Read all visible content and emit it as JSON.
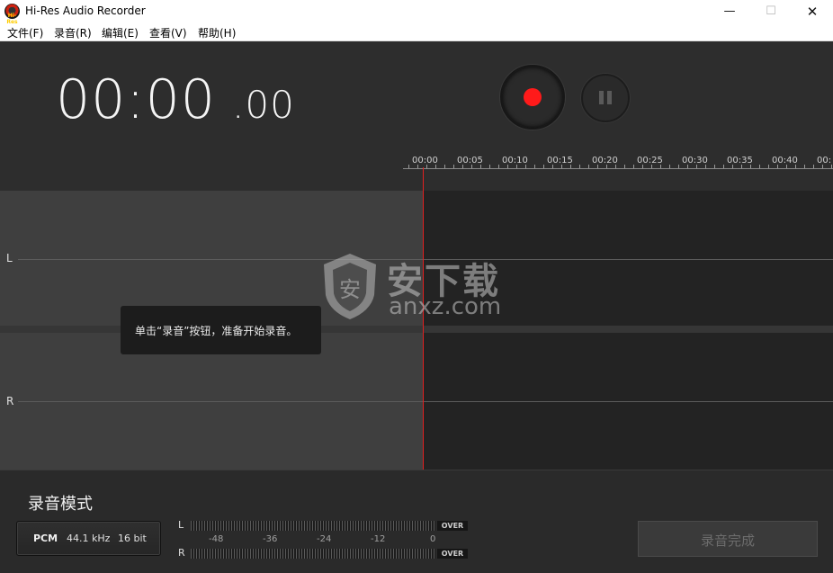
{
  "window": {
    "title": "Hi-Res Audio Recorder",
    "icon_text": "Hi-Res",
    "minimize": "—",
    "maximize": "☐",
    "close": "✕"
  },
  "menu": [
    "文件(F)",
    "录音(R)",
    "编辑(E)",
    "查看(V)",
    "帮助(H)"
  ],
  "timer": {
    "main": "00:00",
    "fraction": ".00"
  },
  "controls": {
    "record_icon": "record-icon",
    "pause_icon": "pause-icon",
    "record_color": "#ff1a1a"
  },
  "timeline": {
    "ticks": [
      "00:00",
      "00:05",
      "00:10",
      "00:15",
      "00:20",
      "00:25",
      "00:30",
      "00:35",
      "00:40",
      "00:"
    ]
  },
  "channels": {
    "left": "L",
    "right": "R"
  },
  "tooltip": "单击“录音”按钮，准备开始录音。",
  "watermark": {
    "cn": "安下载",
    "en": "anxz.com",
    "shield_char": "安"
  },
  "bottom": {
    "mode_title": "录音模式",
    "format": {
      "codec": "PCM",
      "rate": "44.1 kHz",
      "bits": "16 bit"
    },
    "meter": {
      "left": "L",
      "right": "R",
      "over": "OVER",
      "scale": [
        "-48",
        "-36",
        "-24",
        "-12",
        "0"
      ]
    },
    "done_button": "录音完成"
  }
}
